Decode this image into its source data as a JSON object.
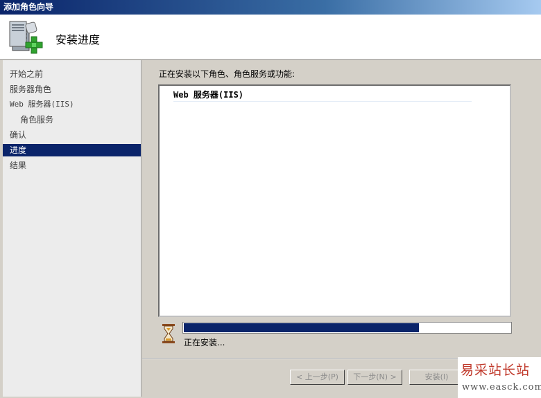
{
  "window": {
    "title": "添加角色向导"
  },
  "header": {
    "title": "安装进度",
    "icon": "server-add-icon"
  },
  "sidebar": {
    "items": [
      {
        "label": "开始之前"
      },
      {
        "label": "服务器角色"
      },
      {
        "label": "Web 服务器(IIS)"
      },
      {
        "label": "角色服务"
      },
      {
        "label": "确认"
      },
      {
        "label": "进度"
      },
      {
        "label": "结果"
      }
    ],
    "active": "进度"
  },
  "main": {
    "label": "正在安装以下角色、角色服务或功能:",
    "list": [
      {
        "label": "Web 服务器(IIS)"
      }
    ],
    "progress": {
      "percent": 72
    },
    "status": "正在安装..."
  },
  "buttons": {
    "prev": "< 上一步(P)",
    "next": "下一步(N) >",
    "install": "安装(I)"
  },
  "watermark": {
    "text": "易采站长站",
    "url": "www.easck.com"
  },
  "colors": {
    "selection": "#0a246a",
    "progress": "#0a246a",
    "watermark": "#c0392b"
  }
}
